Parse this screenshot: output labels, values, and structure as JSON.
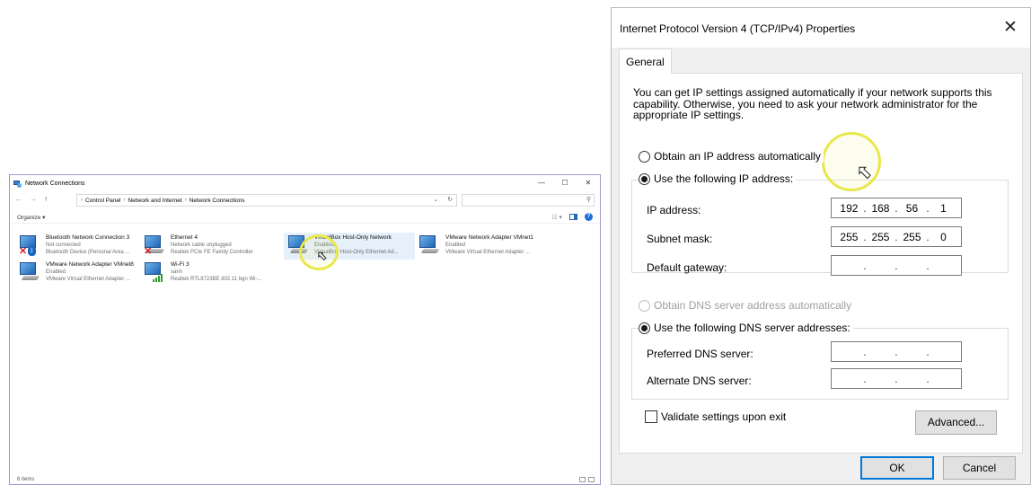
{
  "network_connections": {
    "title": "Network Connections",
    "window_controls": {
      "minimize": "—",
      "maximize": "☐",
      "close": "✕"
    },
    "nav": {
      "back": "←",
      "forward": "→",
      "up": "↑"
    },
    "breadcrumb": [
      "Control Panel",
      "Network and Internet",
      "Network Connections"
    ],
    "breadcrumb_separator": "›",
    "search_placeholder": "",
    "organize_label": "Organize ▾",
    "items": [
      {
        "name": "Bluetooth Network Connection 3",
        "status": "Not connected",
        "device": "Bluetooth Device (Personal Area ...",
        "icon": "bluetooth-adapter-icon",
        "disconnected": true
      },
      {
        "name": "Ethernet 4",
        "status": "Network cable unplugged",
        "device": "Realtek PCIe FE Family Controller",
        "icon": "ethernet-adapter-icon",
        "disconnected": true
      },
      {
        "name": "VirtualBox Host-Only Network",
        "status": "Enabled",
        "device": "VirtualBox Host-Only Ethernet Ad...",
        "icon": "ethernet-adapter-icon",
        "selected": true
      },
      {
        "name": "VMware Network Adapter VMnet1",
        "status": "Enabled",
        "device": "VMware Virtual Ethernet Adapter ...",
        "icon": "ethernet-adapter-icon"
      },
      {
        "name": "VMware Network Adapter VMnet8",
        "status": "Enabled",
        "device": "VMware Virtual Ethernet Adapter ...",
        "icon": "ethernet-adapter-icon"
      },
      {
        "name": "Wi-Fi 3",
        "status": "sarin",
        "device": "Realtek RTL8723BE 802.11 bgn Wi-...",
        "icon": "wifi-adapter-icon"
      }
    ],
    "status_bar": "6 items"
  },
  "ipv4_dialog": {
    "title": "Internet Protocol Version 4 (TCP/IPv4) Properties",
    "close": "✕",
    "tab": "General",
    "description": "You can get IP settings assigned automatically if your network supports this capability. Otherwise, you need to ask your network administrator for the appropriate IP settings.",
    "ip_auto_label": "Obtain an IP address automatically",
    "ip_manual_label": "Use the following IP address:",
    "ip_mode": "manual",
    "ip_address_label": "IP address:",
    "ip_address": [
      "192",
      "168",
      "56",
      "1"
    ],
    "subnet_mask_label": "Subnet mask:",
    "subnet_mask": [
      "255",
      "255",
      "255",
      "0"
    ],
    "default_gateway_label": "Default gateway:",
    "default_gateway": [
      "",
      "",
      "",
      ""
    ],
    "dns_auto_label": "Obtain DNS server address automatically",
    "dns_manual_label": "Use the following DNS server addresses:",
    "dns_mode": "manual",
    "preferred_dns_label": "Preferred DNS server:",
    "preferred_dns": [
      "",
      "",
      "",
      ""
    ],
    "alternate_dns_label": "Alternate DNS server:",
    "alternate_dns": [
      "",
      "",
      "",
      ""
    ],
    "validate_label": "Validate settings upon exit",
    "validate_checked": false,
    "advanced_label": "Advanced...",
    "ok_label": "OK",
    "cancel_label": "Cancel"
  }
}
